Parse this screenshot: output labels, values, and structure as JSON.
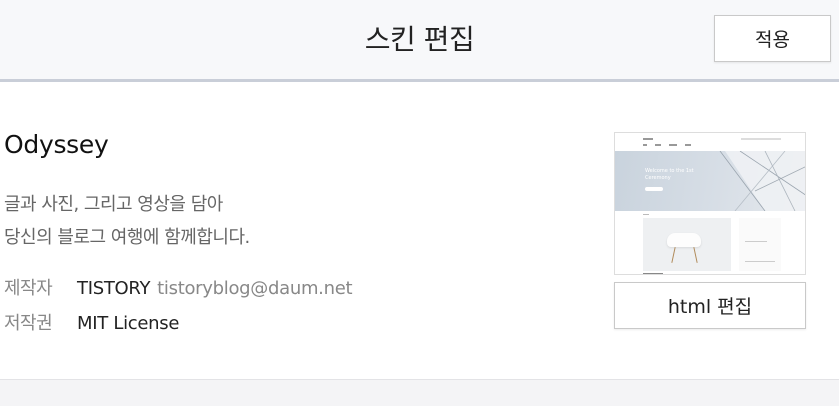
{
  "header": {
    "title": "스킨 편집",
    "apply_label": "적용"
  },
  "skin": {
    "name": "Odyssey",
    "description": [
      "글과 사진, 그리고 영상을 담아",
      "당신의 블로그 여행에 함께합니다."
    ],
    "meta": {
      "author_label": "제작자",
      "author_name": "TISTORY",
      "author_email": "tistoryblog@daum.net",
      "license_label": "저작권",
      "license_value": "MIT License"
    },
    "thumbnail": {
      "hero_text": [
        "Welcome to the 1st",
        "Ceremony"
      ]
    },
    "html_edit_label": "html 편집"
  },
  "colors": {
    "header_bg": "#f7f8fa",
    "header_border": "#c9ced8",
    "muted_text": "#888888"
  }
}
